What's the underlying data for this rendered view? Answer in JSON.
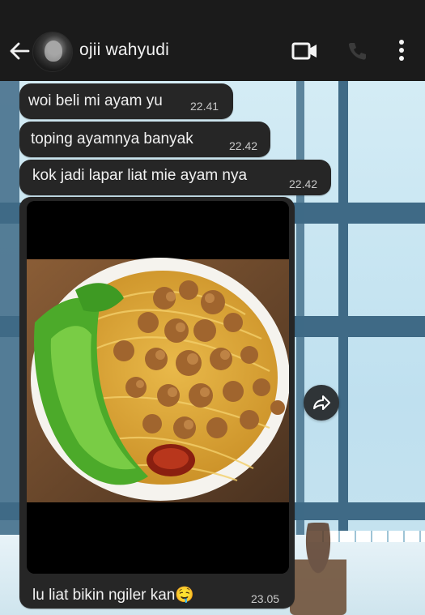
{
  "header": {
    "contact_name": "ojii wahyudi",
    "icons": [
      "back-arrow-icon",
      "avatar",
      "video-call-icon",
      "voice-call-icon",
      "more-options-icon"
    ]
  },
  "messages": [
    {
      "text": "woi beli mi ayam yu",
      "time": "22.41"
    },
    {
      "text": "toping ayamnya banyak",
      "time": "22.42"
    },
    {
      "text": "kok jadi lapar liat mie ayam nya",
      "time": "22.42"
    },
    {
      "text": "lu liat bikin ngiler kan🤤",
      "time": "23.05",
      "has_image": true
    }
  ],
  "colors": {
    "header_bg": "#1b1b1b",
    "bubble_bg": "#262626",
    "text": "#f1f1f1",
    "wallpaper": "#c9e6f2"
  }
}
